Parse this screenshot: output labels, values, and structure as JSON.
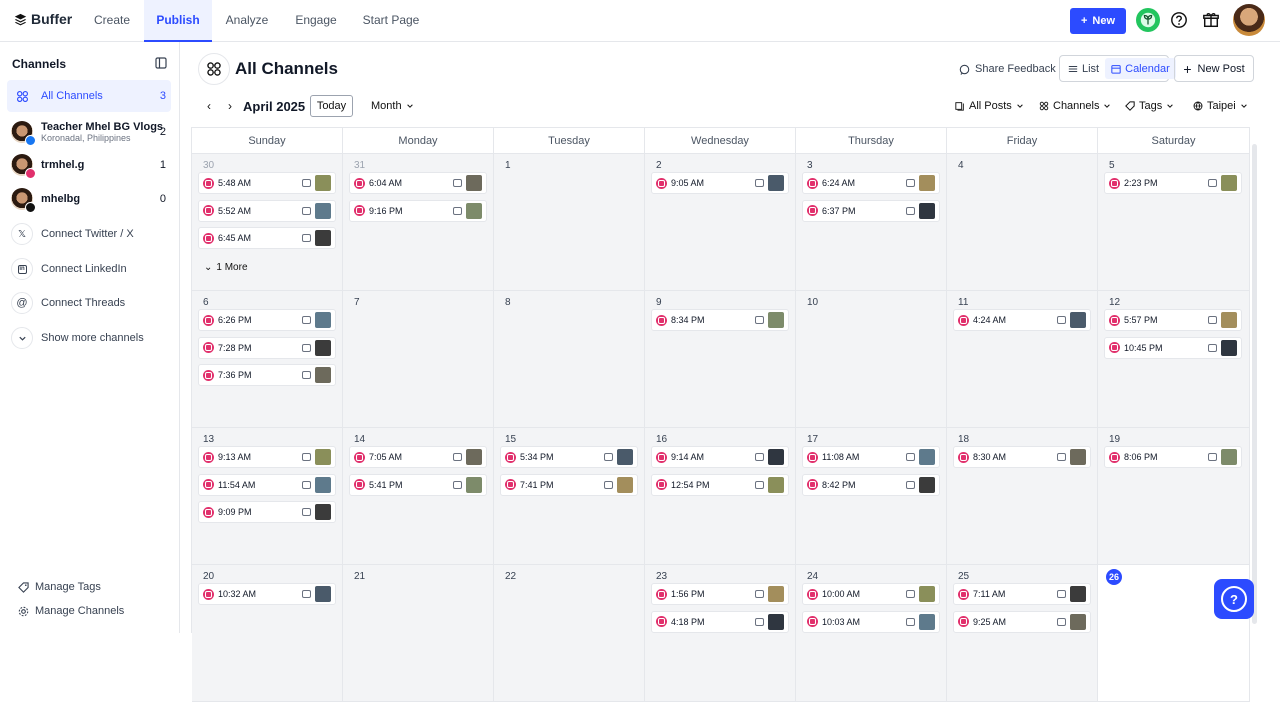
{
  "brand": "Buffer",
  "nav": {
    "tabs": [
      {
        "label": "Create"
      },
      {
        "label": "Publish"
      },
      {
        "label": "Analyze"
      },
      {
        "label": "Engage"
      },
      {
        "label": "Start Page"
      }
    ],
    "active_tab": "Publish",
    "new_label": "New",
    "icons": [
      "plant-icon",
      "help-icon",
      "gift-icon",
      "profile-avatar"
    ]
  },
  "sidebar": {
    "title": "Channels",
    "items": [
      {
        "label": "All Channels",
        "count": "3",
        "icon": "grid-icon"
      },
      {
        "label": "Teacher Mhel BG Vlogs",
        "sub": "Koronadal, Philippines",
        "count": "2",
        "badge": "facebook"
      },
      {
        "label": "trmhel.g",
        "count": "1",
        "badge": "instagram"
      },
      {
        "label": "mhelbg",
        "count": "0",
        "badge": "tiktok"
      },
      {
        "label": "Connect Twitter / X",
        "icon": "x-icon"
      },
      {
        "label": "Connect LinkedIn",
        "icon": "linkedin-icon"
      },
      {
        "label": "Connect Threads",
        "icon": "threads-icon"
      },
      {
        "label": "Show more channels",
        "icon": "chevron-down-icon"
      }
    ],
    "manage_tags": "Manage Tags",
    "manage_channels": "Manage Channels"
  },
  "header": {
    "title": "All Channels",
    "share_feedback": "Share Feedback",
    "view_list": "List",
    "view_calendar": "Calendar",
    "new_post": "New Post"
  },
  "toolbar": {
    "month_label": "April 2025",
    "today": "Today",
    "range": "Month",
    "all_posts": "All Posts",
    "channels": "Channels",
    "tags": "Tags",
    "timezone": "Taipei"
  },
  "calendar": {
    "weekdays": [
      "Sunday",
      "Monday",
      "Tuesday",
      "Wednesday",
      "Thursday",
      "Friday",
      "Saturday"
    ],
    "more_label": "1 More",
    "weeks": [
      [
        {
          "day": "30",
          "muted": true,
          "posts": [
            "5:48 AM",
            "5:52 AM",
            "6:45 AM"
          ],
          "more": true
        },
        {
          "day": "31",
          "muted": true,
          "posts": [
            "6:04 AM",
            "9:16 PM"
          ]
        },
        {
          "day": "1",
          "posts": []
        },
        {
          "day": "2",
          "posts": [
            "9:05 AM"
          ]
        },
        {
          "day": "3",
          "posts": [
            "6:24 AM",
            "6:37 PM"
          ]
        },
        {
          "day": "4",
          "posts": []
        },
        {
          "day": "5",
          "posts": [
            "2:23 PM"
          ]
        }
      ],
      [
        {
          "day": "6",
          "posts": [
            "6:26 PM",
            "7:28 PM",
            "7:36 PM"
          ]
        },
        {
          "day": "7",
          "posts": []
        },
        {
          "day": "8",
          "posts": []
        },
        {
          "day": "9",
          "posts": [
            "8:34 PM"
          ]
        },
        {
          "day": "10",
          "posts": []
        },
        {
          "day": "11",
          "posts": [
            "4:24 AM"
          ]
        },
        {
          "day": "12",
          "posts": [
            "5:57 PM",
            "10:45 PM"
          ]
        }
      ],
      [
        {
          "day": "13",
          "posts": [
            "9:13 AM",
            "11:54 AM",
            "9:09 PM"
          ]
        },
        {
          "day": "14",
          "posts": [
            "7:05 AM",
            "5:41 PM"
          ]
        },
        {
          "day": "15",
          "posts": [
            "5:34 PM",
            "7:41 PM"
          ]
        },
        {
          "day": "16",
          "posts": [
            "9:14 AM",
            "12:54 PM"
          ]
        },
        {
          "day": "17",
          "posts": [
            "11:08 AM",
            "8:42 PM"
          ]
        },
        {
          "day": "18",
          "posts": [
            "8:30 AM"
          ]
        },
        {
          "day": "19",
          "posts": [
            "8:06 PM"
          ]
        }
      ],
      [
        {
          "day": "20",
          "posts": [
            "10:32 AM"
          ]
        },
        {
          "day": "21",
          "posts": []
        },
        {
          "day": "22",
          "posts": []
        },
        {
          "day": "23",
          "posts": [
            "1:56 PM",
            "4:18 PM"
          ]
        },
        {
          "day": "24",
          "posts": [
            "10:00 AM",
            "10:03 AM"
          ]
        },
        {
          "day": "25",
          "posts": [
            "7:11 AM",
            "9:25 AM"
          ]
        },
        {
          "day": "26",
          "today": true,
          "posts": []
        }
      ]
    ]
  },
  "colors": {
    "accent": "#2c4bff",
    "instagram": "#e1306c",
    "cell_bg": "#f3f4f6"
  }
}
